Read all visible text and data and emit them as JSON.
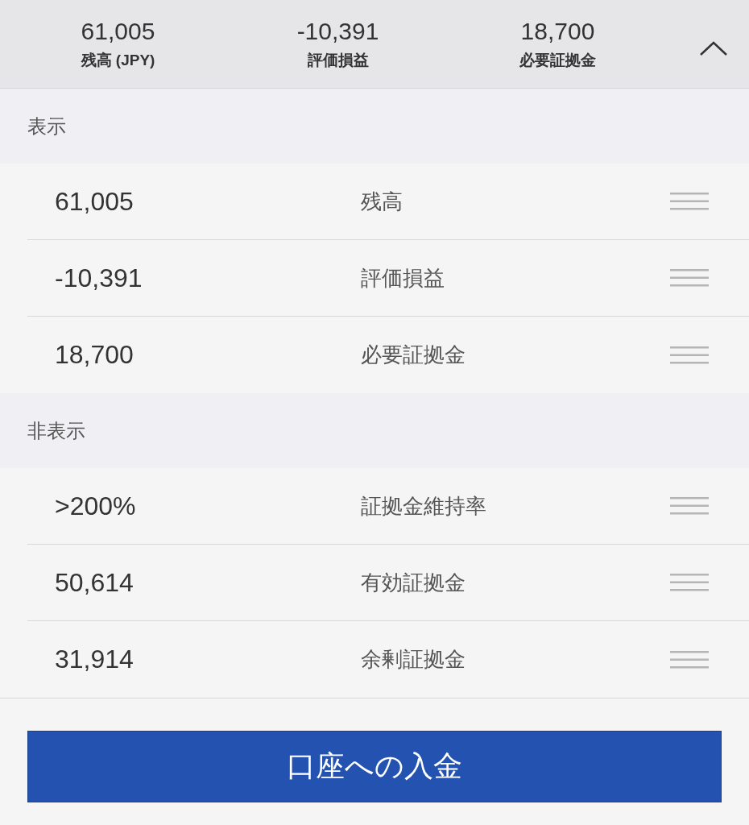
{
  "summary": [
    {
      "value": "61,005",
      "label": "残高 (JPY)"
    },
    {
      "value": "-10,391",
      "label": "評価損益"
    },
    {
      "value": "18,700",
      "label": "必要証拠金"
    }
  ],
  "sections": [
    {
      "title": "表示",
      "rows": [
        {
          "value": "61,005",
          "label": "残高"
        },
        {
          "value": "-10,391",
          "label": "評価損益"
        },
        {
          "value": "18,700",
          "label": "必要証拠金"
        }
      ]
    },
    {
      "title": "非表示",
      "rows": [
        {
          "value": ">200%",
          "label": "証拠金維持率"
        },
        {
          "value": "50,614",
          "label": "有効証拠金"
        },
        {
          "value": "31,914",
          "label": "余剰証拠金"
        }
      ]
    }
  ],
  "deposit_button": "口座への入金"
}
